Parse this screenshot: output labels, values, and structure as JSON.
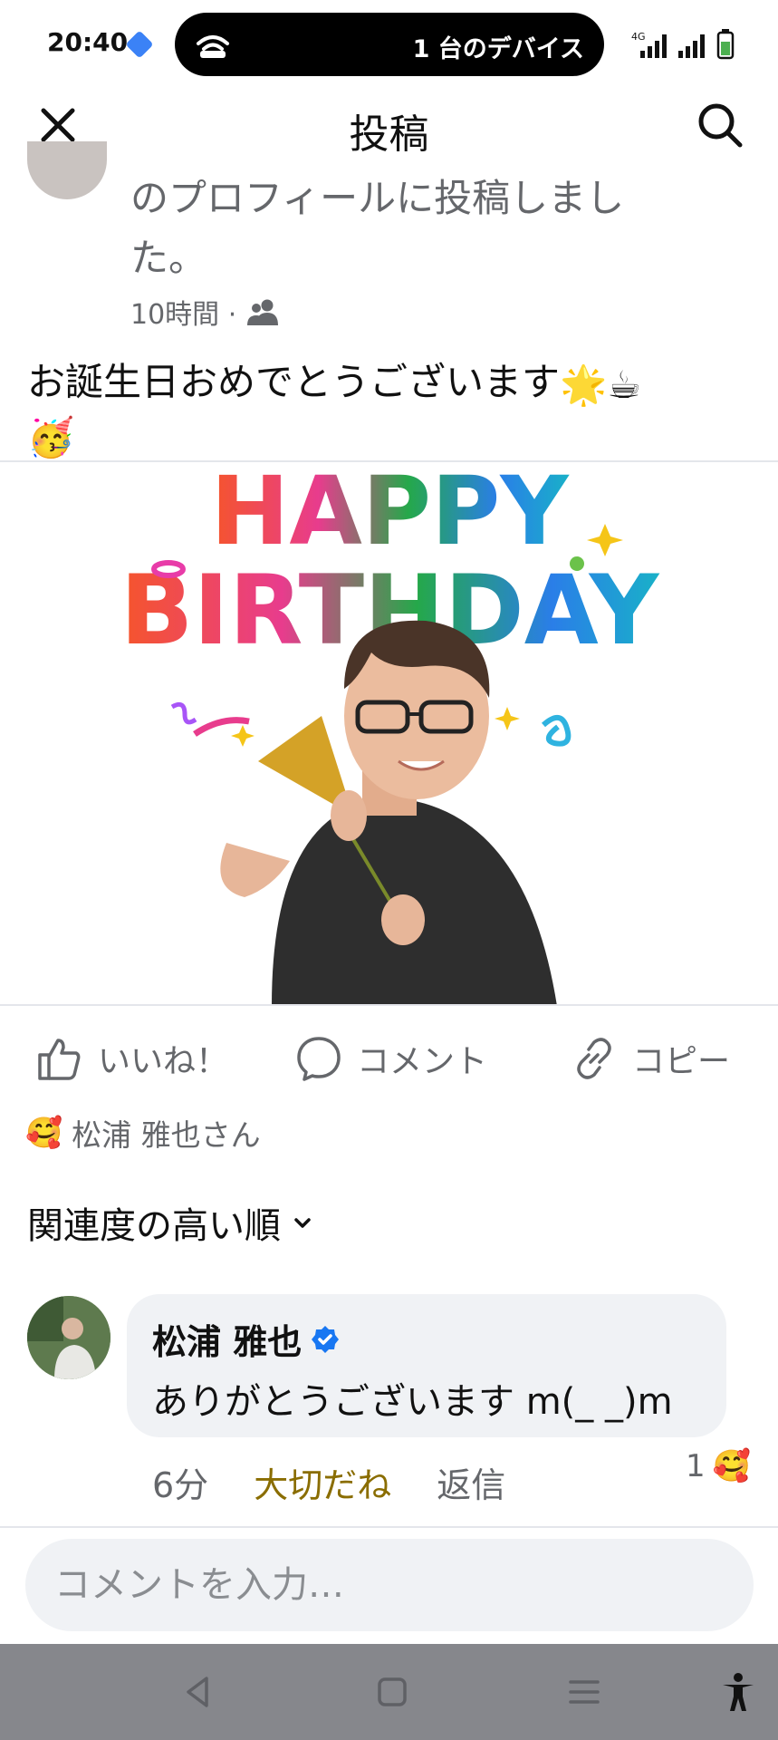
{
  "status_bar": {
    "time": "20:40",
    "pill_text": "1 台のデバイス",
    "network": "4G",
    "icons": [
      "hotspot-icon",
      "signal-icon",
      "battery-icon"
    ]
  },
  "header": {
    "title": "投稿",
    "close_icon": "close-icon",
    "search_icon": "search-icon"
  },
  "post": {
    "meta_text": "のプロフィールに投稿しました。",
    "time": "10時間 ·",
    "audience_icon": "friends-icon",
    "body_text": "お誕生日おめでとうございます",
    "body_emojis": [
      "🌟",
      "☕",
      "🥳"
    ],
    "image_text_line1": "HAPPY",
    "image_text_line2": "BIRTHDAY"
  },
  "actions": {
    "like": "いいね！",
    "comment": "コメント",
    "copy": "コピー"
  },
  "reactions": {
    "emoji": "🥰",
    "names": "松浦 雅也さん"
  },
  "sort": {
    "label": "関連度の高い順"
  },
  "comment": {
    "author": "松浦 雅也",
    "text": "ありがとうございます m(_ _)m",
    "time": "6分",
    "reaction_label": "大切だね",
    "reply_label": "返信",
    "reaction_count": "1",
    "reaction_emoji": "🥰"
  },
  "comment_input": {
    "placeholder": "コメントを入力…"
  },
  "colors": {
    "accent": "#1877f2",
    "muted": "#65676b",
    "bubble": "#f0f2f5",
    "navbar": "#86878c",
    "care": "#8a6d00"
  }
}
